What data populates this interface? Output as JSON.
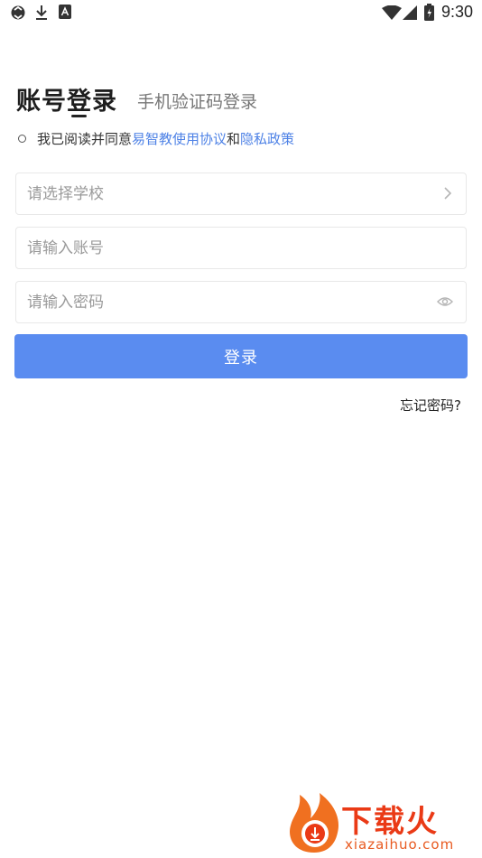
{
  "status_bar": {
    "time": "9:30"
  },
  "tabs": {
    "active": "账号登录",
    "inactive": "手机验证码登录"
  },
  "agreement": {
    "prefix": "我已阅读并同意",
    "terms_link": "易智教使用协议",
    "and": "和",
    "privacy_link": "隐私政策"
  },
  "form": {
    "school_placeholder": "请选择学校",
    "account_placeholder": "请输入账号",
    "password_placeholder": "请输入密码"
  },
  "login_button": "登录",
  "forgot_password": "忘记密码?",
  "watermark": {
    "name": "下载火",
    "url": "xiazaihuo.com"
  },
  "colors": {
    "accent": "#5a8cf0",
    "link": "#4e82e6",
    "watermark": "#ea3a16"
  }
}
